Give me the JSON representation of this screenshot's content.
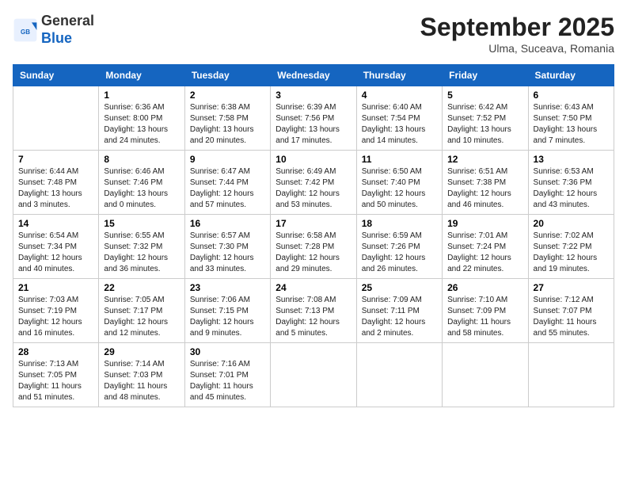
{
  "header": {
    "logo": {
      "general": "General",
      "blue": "Blue"
    },
    "title": "September 2025",
    "location": "Ulma, Suceava, Romania"
  },
  "days_of_week": [
    "Sunday",
    "Monday",
    "Tuesday",
    "Wednesday",
    "Thursday",
    "Friday",
    "Saturday"
  ],
  "weeks": [
    [
      {
        "day": "",
        "info": ""
      },
      {
        "day": "1",
        "info": "Sunrise: 6:36 AM\nSunset: 8:00 PM\nDaylight: 13 hours\nand 24 minutes."
      },
      {
        "day": "2",
        "info": "Sunrise: 6:38 AM\nSunset: 7:58 PM\nDaylight: 13 hours\nand 20 minutes."
      },
      {
        "day": "3",
        "info": "Sunrise: 6:39 AM\nSunset: 7:56 PM\nDaylight: 13 hours\nand 17 minutes."
      },
      {
        "day": "4",
        "info": "Sunrise: 6:40 AM\nSunset: 7:54 PM\nDaylight: 13 hours\nand 14 minutes."
      },
      {
        "day": "5",
        "info": "Sunrise: 6:42 AM\nSunset: 7:52 PM\nDaylight: 13 hours\nand 10 minutes."
      },
      {
        "day": "6",
        "info": "Sunrise: 6:43 AM\nSunset: 7:50 PM\nDaylight: 13 hours\nand 7 minutes."
      }
    ],
    [
      {
        "day": "7",
        "info": "Sunrise: 6:44 AM\nSunset: 7:48 PM\nDaylight: 13 hours\nand 3 minutes."
      },
      {
        "day": "8",
        "info": "Sunrise: 6:46 AM\nSunset: 7:46 PM\nDaylight: 13 hours\nand 0 minutes."
      },
      {
        "day": "9",
        "info": "Sunrise: 6:47 AM\nSunset: 7:44 PM\nDaylight: 12 hours\nand 57 minutes."
      },
      {
        "day": "10",
        "info": "Sunrise: 6:49 AM\nSunset: 7:42 PM\nDaylight: 12 hours\nand 53 minutes."
      },
      {
        "day": "11",
        "info": "Sunrise: 6:50 AM\nSunset: 7:40 PM\nDaylight: 12 hours\nand 50 minutes."
      },
      {
        "day": "12",
        "info": "Sunrise: 6:51 AM\nSunset: 7:38 PM\nDaylight: 12 hours\nand 46 minutes."
      },
      {
        "day": "13",
        "info": "Sunrise: 6:53 AM\nSunset: 7:36 PM\nDaylight: 12 hours\nand 43 minutes."
      }
    ],
    [
      {
        "day": "14",
        "info": "Sunrise: 6:54 AM\nSunset: 7:34 PM\nDaylight: 12 hours\nand 40 minutes."
      },
      {
        "day": "15",
        "info": "Sunrise: 6:55 AM\nSunset: 7:32 PM\nDaylight: 12 hours\nand 36 minutes."
      },
      {
        "day": "16",
        "info": "Sunrise: 6:57 AM\nSunset: 7:30 PM\nDaylight: 12 hours\nand 33 minutes."
      },
      {
        "day": "17",
        "info": "Sunrise: 6:58 AM\nSunset: 7:28 PM\nDaylight: 12 hours\nand 29 minutes."
      },
      {
        "day": "18",
        "info": "Sunrise: 6:59 AM\nSunset: 7:26 PM\nDaylight: 12 hours\nand 26 minutes."
      },
      {
        "day": "19",
        "info": "Sunrise: 7:01 AM\nSunset: 7:24 PM\nDaylight: 12 hours\nand 22 minutes."
      },
      {
        "day": "20",
        "info": "Sunrise: 7:02 AM\nSunset: 7:22 PM\nDaylight: 12 hours\nand 19 minutes."
      }
    ],
    [
      {
        "day": "21",
        "info": "Sunrise: 7:03 AM\nSunset: 7:19 PM\nDaylight: 12 hours\nand 16 minutes."
      },
      {
        "day": "22",
        "info": "Sunrise: 7:05 AM\nSunset: 7:17 PM\nDaylight: 12 hours\nand 12 minutes."
      },
      {
        "day": "23",
        "info": "Sunrise: 7:06 AM\nSunset: 7:15 PM\nDaylight: 12 hours\nand 9 minutes."
      },
      {
        "day": "24",
        "info": "Sunrise: 7:08 AM\nSunset: 7:13 PM\nDaylight: 12 hours\nand 5 minutes."
      },
      {
        "day": "25",
        "info": "Sunrise: 7:09 AM\nSunset: 7:11 PM\nDaylight: 12 hours\nand 2 minutes."
      },
      {
        "day": "26",
        "info": "Sunrise: 7:10 AM\nSunset: 7:09 PM\nDaylight: 11 hours\nand 58 minutes."
      },
      {
        "day": "27",
        "info": "Sunrise: 7:12 AM\nSunset: 7:07 PM\nDaylight: 11 hours\nand 55 minutes."
      }
    ],
    [
      {
        "day": "28",
        "info": "Sunrise: 7:13 AM\nSunset: 7:05 PM\nDaylight: 11 hours\nand 51 minutes."
      },
      {
        "day": "29",
        "info": "Sunrise: 7:14 AM\nSunset: 7:03 PM\nDaylight: 11 hours\nand 48 minutes."
      },
      {
        "day": "30",
        "info": "Sunrise: 7:16 AM\nSunset: 7:01 PM\nDaylight: 11 hours\nand 45 minutes."
      },
      {
        "day": "",
        "info": ""
      },
      {
        "day": "",
        "info": ""
      },
      {
        "day": "",
        "info": ""
      },
      {
        "day": "",
        "info": ""
      }
    ]
  ]
}
